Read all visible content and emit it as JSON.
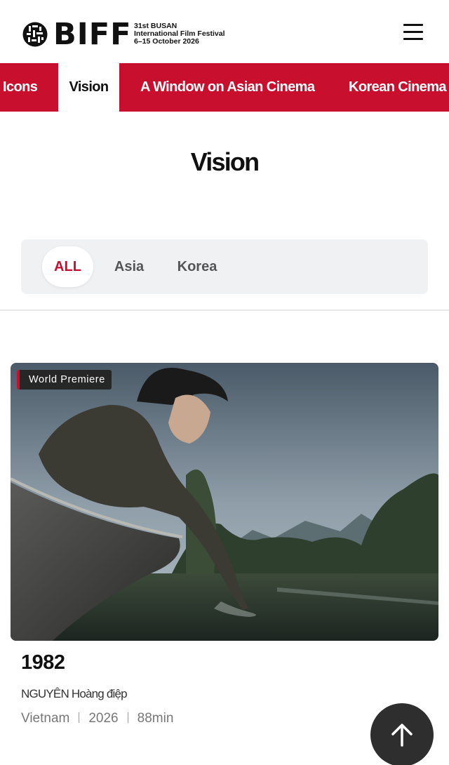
{
  "header": {
    "logo_text": "BIFF",
    "edition": "31st BUSAN",
    "festival_name": "International Film Festival",
    "dates": "6–15 October 2026",
    "menu_icon": "hamburger-menu-icon"
  },
  "category_tabs": [
    {
      "label": "Icons",
      "active": false
    },
    {
      "label": "Vision",
      "active": true
    },
    {
      "label": "A Window on Asian Cinema",
      "active": false
    },
    {
      "label": "Korean Cinema",
      "active": false
    }
  ],
  "page_title": "Vision",
  "filters": [
    {
      "label": "ALL",
      "active": true
    },
    {
      "label": "Asia",
      "active": false
    },
    {
      "label": "Korea",
      "active": false
    }
  ],
  "film": {
    "badge": "World Premiere",
    "title": "1982",
    "director": "NGUYÊN Hoàng điệp",
    "country": "Vietnam",
    "year": "2026",
    "runtime": "88min"
  },
  "back_to_top_icon": "arrow-up-icon",
  "colors": {
    "brand_red": "#c8102e",
    "text_dark": "#111111",
    "filter_bg": "#f0f1f3"
  }
}
